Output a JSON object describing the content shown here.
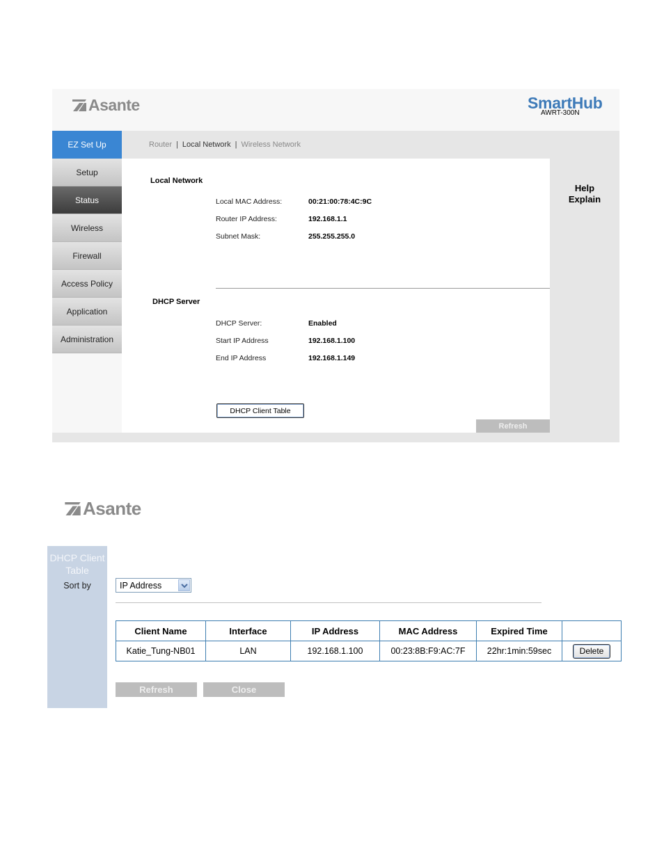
{
  "panel1": {
    "brand": "Asante",
    "product": "SmartHub",
    "model": "AWRT-300N",
    "ez_setup": "EZ Set Up",
    "breadcrumb": {
      "item1": "Router",
      "sep": "|",
      "item2": "Local Network",
      "item3": "Wireless Network"
    },
    "nav": [
      "Setup",
      "Status",
      "Wireless",
      "Firewall",
      "Access Policy",
      "Application",
      "Administration"
    ],
    "nav_active": "Status",
    "help": {
      "line1": "Help",
      "line2": "Explain"
    },
    "local_network": {
      "title": "Local Network",
      "mac_label": "Local MAC Address:",
      "mac_value": "00:21:00:78:4C:9C",
      "ip_label": "Router IP Address:",
      "ip_value": "192.168.1.1",
      "mask_label": "Subnet Mask:",
      "mask_value": "255.255.255.0"
    },
    "dhcp_server": {
      "title": "DHCP Server",
      "server_label": "DHCP Server:",
      "server_value": "Enabled",
      "start_label": "Start IP Address",
      "start_value": "192.168.1.100",
      "end_label": "End IP Address",
      "end_value": "192.168.1.149"
    },
    "client_table_button": "DHCP Client Table",
    "refresh_button": "Refresh"
  },
  "panel2": {
    "brand": "Asante",
    "side_title_line1": "DHCP Client",
    "side_title_line2": "Table",
    "sort_label": "Sort by",
    "sort_value": "IP Address",
    "table": {
      "headers": [
        "Client Name",
        "Interface",
        "IP Address",
        "MAC Address",
        "Expired Time",
        ""
      ],
      "rows": [
        {
          "client_name": "Katie_Tung-NB01",
          "interface": "LAN",
          "ip": "192.168.1.100",
          "mac": "00:23:8B:F9:AC:7F",
          "expired": "22hr:1min:59sec",
          "action": "Delete"
        }
      ]
    },
    "refresh_button": "Refresh",
    "close_button": "Close"
  },
  "colors": {
    "ez_blue": "#3a86d3",
    "smarthub_blue": "#3d7ab8",
    "sidebar_blue": "#c8d4e4",
    "table_border": "#3c7db0",
    "disabled_grey": "#bdbdbd"
  },
  "icons": {
    "brand": "asante-logo-icon",
    "dropdown": "chevron-down-icon"
  }
}
